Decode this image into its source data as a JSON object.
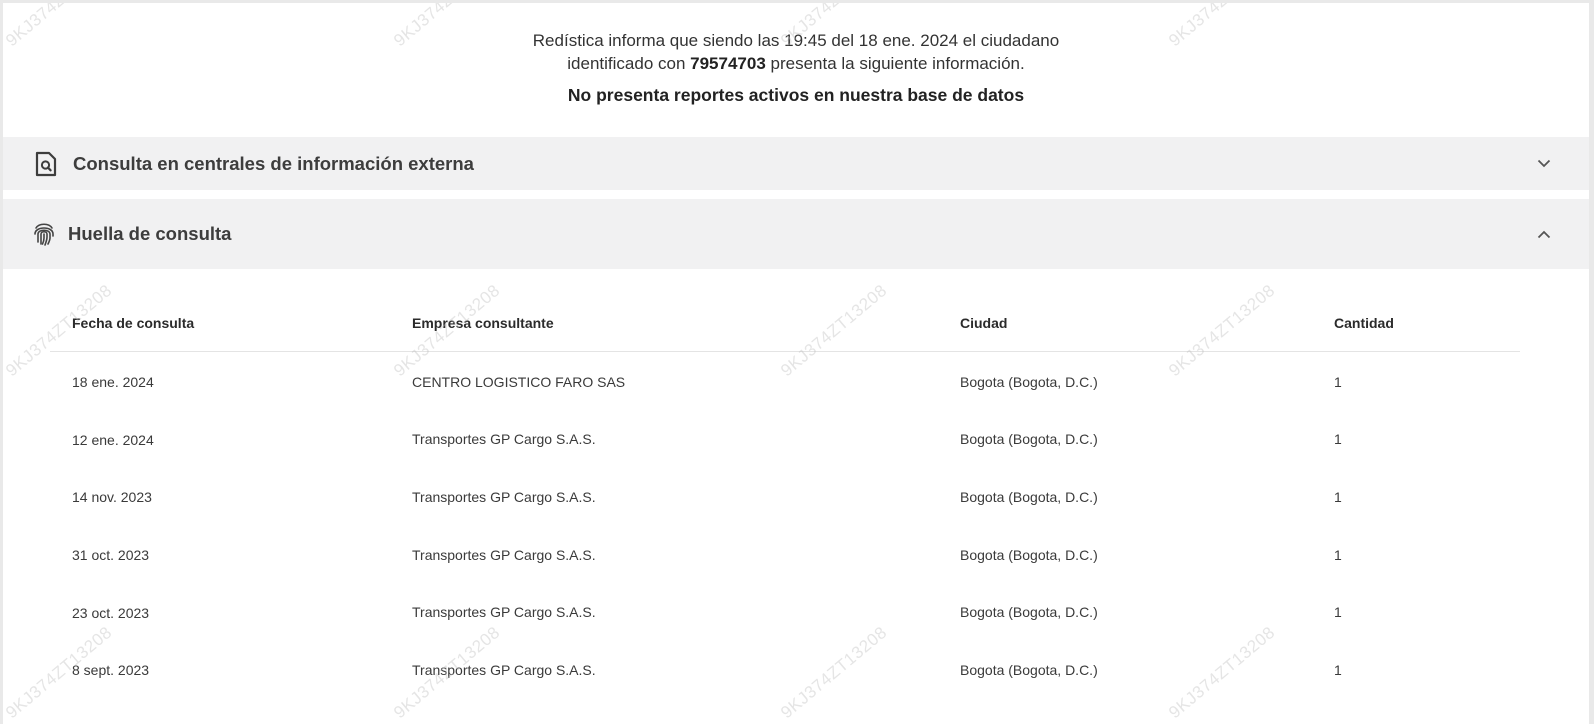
{
  "intro": {
    "line1": "Redística informa que siendo las 19:45 del 18 ene. 2024 el ciudadano",
    "line2_prefix": "identificado con",
    "citizen_id": "79574703",
    "line2_suffix": "presenta la siguiente información.",
    "alert": "No presenta reportes activos en nuestra base de datos"
  },
  "panels": {
    "external": {
      "title": "Consulta en centrales de información externa",
      "icon": "document-search-icon",
      "state": "collapsed"
    },
    "footprint": {
      "title": "Huella de consulta",
      "icon": "fingerprint-icon",
      "state": "expanded"
    }
  },
  "watermark": "9KJ374ZT13208",
  "table": {
    "headers": [
      "Fecha de consulta",
      "Empresa consultante",
      "Ciudad",
      "Cantidad"
    ],
    "rows": [
      [
        "18 ene. 2024",
        "CENTRO LOGISTICO FARO SAS",
        "Bogota (Bogota, D.C.)",
        "1"
      ],
      [
        "12 ene. 2024",
        "Transportes GP Cargo S.A.S.",
        "Bogota (Bogota, D.C.)",
        "1"
      ],
      [
        "14 nov. 2023",
        "Transportes GP Cargo S.A.S.",
        "Bogota (Bogota, D.C.)",
        "1"
      ],
      [
        "31 oct. 2023",
        "Transportes GP Cargo S.A.S.",
        "Bogota (Bogota, D.C.)",
        "1"
      ],
      [
        "23 oct. 2023",
        "Transportes GP Cargo S.A.S.",
        "Bogota (Bogota, D.C.)",
        "1"
      ],
      [
        "8 sept. 2023",
        "Transportes GP Cargo S.A.S.",
        "Bogota (Bogota, D.C.)",
        "1"
      ]
    ]
  }
}
